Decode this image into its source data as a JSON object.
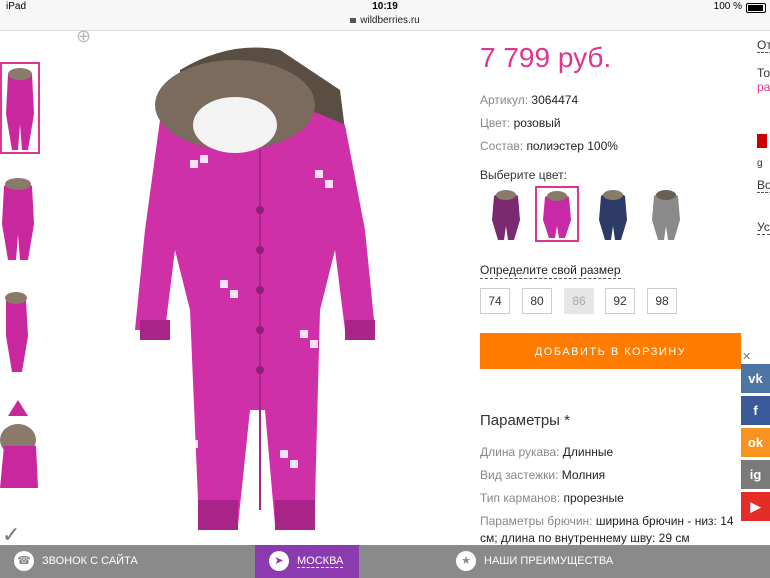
{
  "status": {
    "device": "iPad",
    "time": "10:19",
    "battery": "100 %"
  },
  "url": "wildberries.ru",
  "product": {
    "price": "7 799 руб.",
    "article_label": "Артикул:",
    "article": "3064474",
    "color_label": "Цвет:",
    "color": "розовый",
    "material_label": "Состав:",
    "material": "полиэстер 100%",
    "choose_color": "Выберите цвет:",
    "swatches": [
      {
        "color": "#7a2a6f"
      },
      {
        "color": "#c82aa6"
      },
      {
        "color": "#2e3a66"
      },
      {
        "color": "#8a8a8a"
      }
    ],
    "size_label": "Определите свой размер",
    "sizes": [
      "74",
      "80",
      "86",
      "92",
      "98"
    ],
    "buy_label": "ДОБАВИТЬ В КОРЗИНУ"
  },
  "params": {
    "title": "Параметры *",
    "rows": [
      {
        "label": "Длина рукава:",
        "value": "Длинные"
      },
      {
        "label": "Вид застежки:",
        "value": "Молния"
      },
      {
        "label": "Тип карманов:",
        "value": "прорезные"
      },
      {
        "label": "Параметры брючин:",
        "value": "ширина брючин - низ: 14 см; длина по внутреннему шву: 29 см"
      }
    ]
  },
  "right_edge": [
    "От",
    "То",
    "ра",
    "g",
    "Во",
    "Ус"
  ],
  "social": [
    {
      "icon": "vk-icon",
      "label": "vk",
      "color": "#4c75a3"
    },
    {
      "icon": "facebook-icon",
      "label": "f",
      "color": "#3b5998"
    },
    {
      "icon": "odnoklassniki-icon",
      "label": "ok",
      "color": "#f7931e"
    },
    {
      "icon": "instagram-icon",
      "label": "ig",
      "color": "#7a7a7a"
    },
    {
      "icon": "youtube-icon",
      "label": "▶",
      "color": "#e52d27"
    }
  ],
  "bottom": {
    "call": "ЗВОНОК С САЙТА",
    "city": "МОСКВА",
    "benefits": "НАШИ ПРЕИМУЩЕСТВА"
  },
  "colors": {
    "accent": "#e0348f",
    "buy": "#ff7c00",
    "city_bg": "#8b3ab0"
  }
}
